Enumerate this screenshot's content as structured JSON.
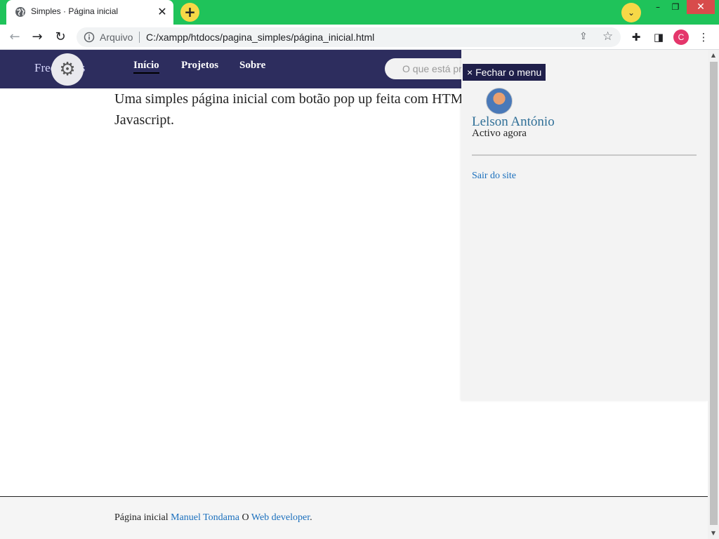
{
  "browser": {
    "tab": {
      "title": "Simples · Página inicial",
      "close": "✕",
      "favicon": "globe-icon"
    },
    "new_tab": "+",
    "tab_search": "⌄",
    "window": {
      "minimize": "–",
      "maximize": "❐",
      "close": "✕"
    },
    "toolbar": {
      "back": "←",
      "forward": "→",
      "reload": "↻",
      "scheme_label": "Arquivo",
      "url": "C:/xampp/htdocs/pagina_simples/página_inicial.html",
      "share": "⇪",
      "bookmark": "☆",
      "extensions": "✚",
      "side_panel": "◨",
      "profile_initial": "C",
      "menu": "⋮"
    }
  },
  "site": {
    "brand": "Free grátis",
    "settings_icon": "⚙",
    "nav": [
      {
        "label": "Início"
      },
      {
        "label": "Projetos"
      },
      {
        "label": "Sobre"
      }
    ],
    "search_placeholder": "O que está pr",
    "intro": "Uma simples página inicial com botão pop up feita com HTML, CSS e Javascript.",
    "footer": {
      "prefix": "Página inicial ",
      "author": "Manuel Tondama",
      "middle": " O ",
      "role": "Web developer",
      "suffix": "."
    }
  },
  "sidemenu": {
    "close_label": "× Fechar o menu",
    "user_name": "Lelson António",
    "status": "Activo agora",
    "logout": "Sair do site"
  },
  "scrollbar": {
    "up": "▲",
    "down": "▼"
  },
  "colors": {
    "tabstrip": "#1fc35a",
    "header": "#2d2d5e",
    "link": "#1a6fbd",
    "accent_yellow": "#f6d847"
  }
}
